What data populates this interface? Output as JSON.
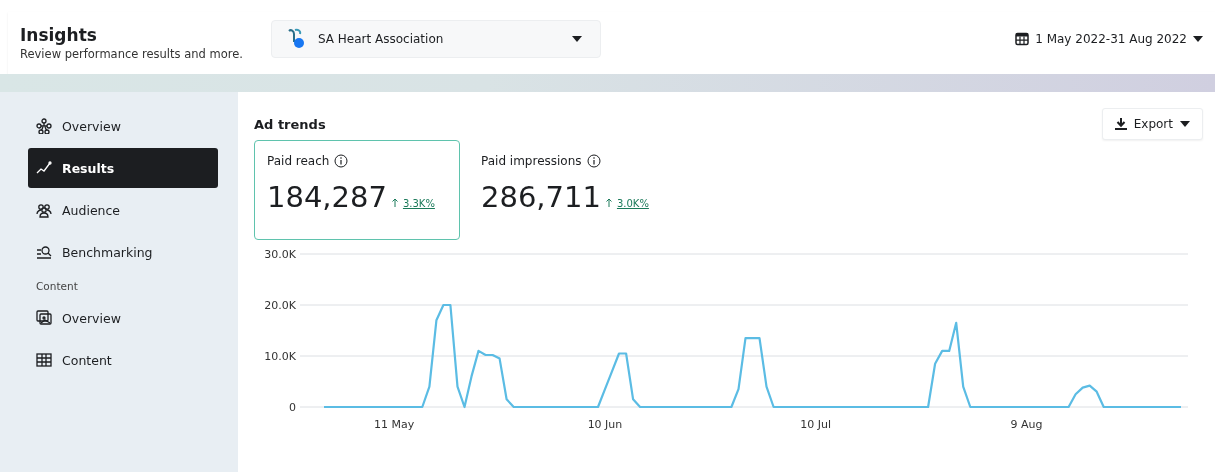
{
  "header": {
    "title": "Insights",
    "subtitle": "Review performance results and more.",
    "account": "SA Heart Association",
    "date_range": "1 May 2022-31 Aug 2022"
  },
  "sidebar": {
    "items": [
      {
        "kind": "nav",
        "label": "Overview",
        "selected": false
      },
      {
        "kind": "nav",
        "label": "Results",
        "selected": true
      },
      {
        "kind": "nav",
        "label": "Audience",
        "selected": false
      },
      {
        "kind": "nav",
        "label": "Benchmarking",
        "selected": false
      },
      {
        "kind": "section",
        "label": "Content"
      },
      {
        "kind": "nav",
        "label": "Overview",
        "selected": false
      },
      {
        "kind": "nav",
        "label": "Content",
        "selected": false
      }
    ]
  },
  "ad_trends": {
    "title": "Ad trends",
    "export": "Export",
    "metrics": [
      {
        "label": "Paid reach",
        "value": "184,287",
        "change": "3.3K%",
        "selected": true
      },
      {
        "label": "Paid impressions",
        "value": "286,711",
        "change": "3.0K%",
        "selected": false
      }
    ],
    "chart_data": {
      "type": "line",
      "ylim": [
        0,
        30000
      ],
      "categories": [
        null,
        null,
        null,
        null,
        null,
        null,
        null,
        null,
        null,
        null,
        "11 May",
        null,
        null,
        null,
        null,
        null,
        null,
        null,
        null,
        null,
        null,
        null,
        null,
        null,
        null,
        null,
        null,
        null,
        null,
        null,
        null,
        null,
        null,
        null,
        null,
        null,
        null,
        null,
        null,
        null,
        "10 Jun",
        null,
        null,
        null,
        null,
        null,
        null,
        null,
        null,
        null,
        null,
        null,
        null,
        null,
        null,
        null,
        null,
        null,
        null,
        null,
        null,
        null,
        null,
        null,
        null,
        null,
        null,
        null,
        null,
        null,
        "10 Jul",
        null,
        null,
        null,
        null,
        null,
        null,
        null,
        null,
        null,
        null,
        null,
        null,
        null,
        null,
        null,
        null,
        null,
        null,
        null,
        null,
        null,
        null,
        null,
        null,
        null,
        null,
        null,
        null,
        null,
        "9 Aug",
        null,
        null,
        null,
        null,
        null,
        null,
        null,
        null,
        null,
        null,
        null,
        null,
        null,
        null,
        null,
        null,
        null,
        null,
        null,
        null,
        null,
        null
      ],
      "yticks": [
        {
          "value": 0,
          "label": "0"
        },
        {
          "value": 10000,
          "label": "10.0K"
        },
        {
          "value": 20000,
          "label": "20.0K"
        },
        {
          "value": 30000,
          "label": "30.0K"
        }
      ],
      "series": [
        {
          "color": "#5bbce4",
          "values": [
            0,
            0,
            0,
            0,
            0,
            0,
            0,
            0,
            0,
            0,
            0,
            0,
            0,
            0,
            0,
            4000,
            17000,
            20000,
            20000,
            4000,
            0,
            6000,
            11000,
            10200,
            10200,
            9500,
            1500,
            0,
            0,
            0,
            0,
            0,
            0,
            0,
            0,
            0,
            0,
            0,
            0,
            0,
            3500,
            7000,
            10500,
            10500,
            1500,
            0,
            0,
            0,
            0,
            0,
            0,
            0,
            0,
            0,
            0,
            0,
            0,
            0,
            0,
            3500,
            13500,
            13500,
            13500,
            4000,
            0,
            0,
            0,
            0,
            0,
            0,
            0,
            0,
            0,
            0,
            0,
            0,
            0,
            0,
            0,
            0,
            0,
            0,
            0,
            0,
            0,
            0,
            0,
            8500,
            11000,
            11000,
            16500,
            4000,
            0,
            0,
            0,
            0,
            0,
            0,
            0,
            0,
            0,
            0,
            0,
            0,
            0,
            0,
            0,
            2500,
            3800,
            4200,
            3000,
            0,
            0,
            0,
            0,
            0,
            0,
            0,
            0,
            0,
            0,
            0,
            0
          ]
        }
      ]
    }
  }
}
